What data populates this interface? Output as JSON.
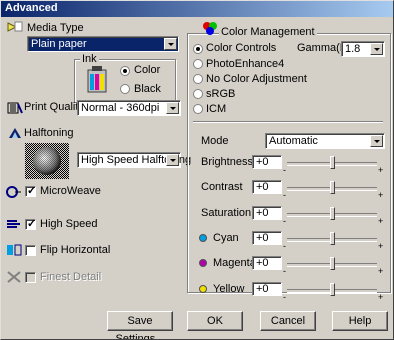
{
  "window": {
    "title": "Advanced"
  },
  "media_type": {
    "label": "Media Type",
    "value": "Plain paper"
  },
  "ink": {
    "label": "Ink",
    "options": [
      "Color",
      "Black"
    ],
    "selected": "Color"
  },
  "print_quality": {
    "label": "Print Quality",
    "value": "Normal - 360dpi"
  },
  "halftoning": {
    "label": "Halftoning",
    "value": "High Speed Halftoning"
  },
  "checkboxes": {
    "microweave": {
      "label": "MicroWeave",
      "checked": true
    },
    "high_speed": {
      "label": "High Speed",
      "checked": true
    },
    "flip_horizontal": {
      "label": "Flip Horizontal",
      "checked": false
    },
    "finest_detail": {
      "label": "Finest Detail",
      "checked": false,
      "disabled": true
    }
  },
  "color_management": {
    "title": "Color Management",
    "options": [
      "Color Controls",
      "PhotoEnhance4",
      "No Color Adjustment",
      "sRGB",
      "ICM"
    ],
    "selected": "Color Controls",
    "gamma_label": "Gamma(D)",
    "gamma_value": "1.8"
  },
  "mode": {
    "label": "Mode",
    "value": "Automatic"
  },
  "sliders": [
    {
      "label": "Brightness",
      "value": "+0",
      "level": 0,
      "dot": ""
    },
    {
      "label": "Contrast",
      "value": "+0",
      "level": 0,
      "dot": ""
    },
    {
      "label": "Saturation",
      "value": "+0",
      "level": 0,
      "dot": ""
    },
    {
      "label": "Cyan",
      "value": "+0",
      "level": 0,
      "dot": "#00a0e0"
    },
    {
      "label": "Magenta",
      "value": "+0",
      "level": 0,
      "dot": "#b000b0"
    },
    {
      "label": "Yellow",
      "value": "+0",
      "level": 0,
      "dot": "#f0e000"
    }
  ],
  "slider_marks": {
    "minus": "-",
    "plus": "+"
  },
  "buttons": {
    "save_settings": "Save Settings...",
    "ok": "OK",
    "cancel": "Cancel",
    "help": "Help"
  },
  "colors": {
    "title_start": "#0a246a",
    "title_end": "#a6caf0",
    "face": "#d4d0c8"
  }
}
